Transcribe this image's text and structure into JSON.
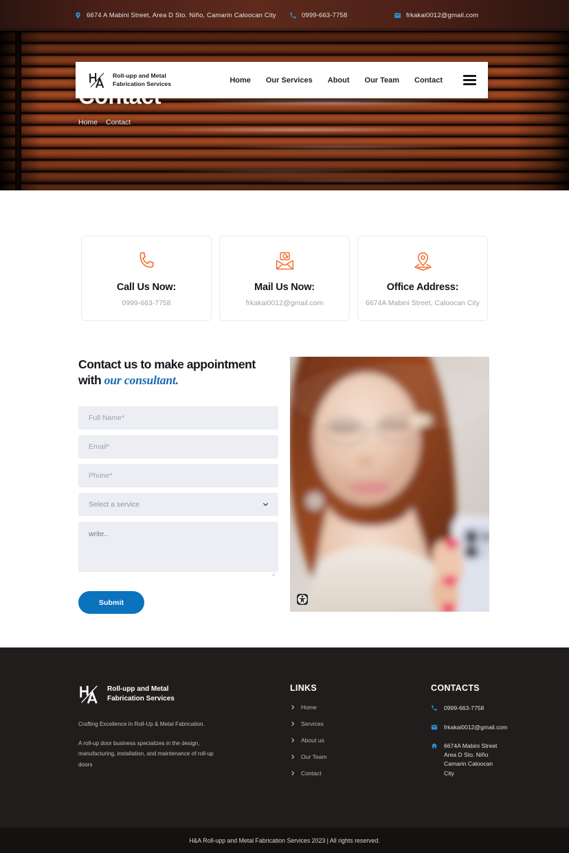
{
  "topbar": {
    "address": "6674 A Mabini Street, Area D Sto. Niño, Camarin Caloocan City",
    "phone": "0999-663-7758",
    "email": "frkakai0012@gmail.com",
    "address_icon": "location-pin-icon",
    "phone_icon": "phone-icon",
    "email_icon": "envelope-icon",
    "icon_color": "#2b8fd8"
  },
  "header": {
    "logo_text_line1": "Roll-upp and Metal",
    "logo_text_line2": "Fabrication Services",
    "logo_mark": "ha-monogram-logo",
    "nav": [
      {
        "label": "Home"
      },
      {
        "label": "Our Services"
      },
      {
        "label": "About"
      },
      {
        "label": "Our Team"
      },
      {
        "label": "Contact"
      }
    ],
    "menu_icon": "hamburger-menu-icon"
  },
  "hero": {
    "title": "Contact",
    "breadcrumbs": [
      {
        "label": "Home"
      },
      {
        "label": "Contact"
      }
    ],
    "background": "brown-rollup-door-image"
  },
  "contact_cards": [
    {
      "icon": "phone-call-icon",
      "title": "Call Us Now:",
      "value": "0999-663-7758"
    },
    {
      "icon": "open-mail-at-icon",
      "title": "Mail Us Now:",
      "value": "frkakai0012@gmail.com"
    },
    {
      "icon": "map-location-pin-icon",
      "title": "Office Address:",
      "value": "6674A Mabini Street, Caloocan City"
    }
  ],
  "form": {
    "heading_plain": "Contact us to make appointment with ",
    "heading_accent": "our consultant.",
    "accent_color": "#1668b3",
    "fields": {
      "fullname_placeholder": "Full Name*",
      "email_placeholder": "Email*",
      "phone_placeholder": "Phone*",
      "service_selected": "Select a service",
      "message_placeholder": "write.."
    },
    "submit_label": "Submit",
    "submit_color": "#0b72bd",
    "dropdown_icon": "chevron-down-icon"
  },
  "photo": {
    "alt": "woman-with-glasses-holding-phone",
    "a11y_badge_icon": "accessibility-icon"
  },
  "footer": {
    "brand_line1": "Roll-upp and Metal",
    "brand_line2": "Fabrication Services",
    "logo_mark": "ha-monogram-logo",
    "tagline": "Crafting Excellence in Roll-Up & Metal Fabrication.",
    "description": "A roll-up door business specializes in the design, manufacturing, installation, and maintenance of roll-up doors",
    "links_title": "LINKS",
    "links": [
      {
        "label": "Home"
      },
      {
        "label": "Services"
      },
      {
        "label": "About us"
      },
      {
        "label": "Our Team"
      },
      {
        "label": "Contact"
      }
    ],
    "link_icon": "chevron-right-icon",
    "contacts_title": "CONTACTS",
    "contacts": {
      "phone": "0999-663-7758",
      "email": "frkakai0012@gmail.com",
      "address_line1": "6674A Mabini Street",
      "address_line2": "Area D Sto. Niño",
      "address_line3": "Camarin Caloocan",
      "address_line4": "City",
      "phone_icon": "phone-icon",
      "email_icon": "envelope-icon",
      "address_icon": "home-icon"
    }
  },
  "copyright": {
    "text": "H&A Roll-upp and Metal Fabrication Services 2023 | All rights reserved."
  }
}
